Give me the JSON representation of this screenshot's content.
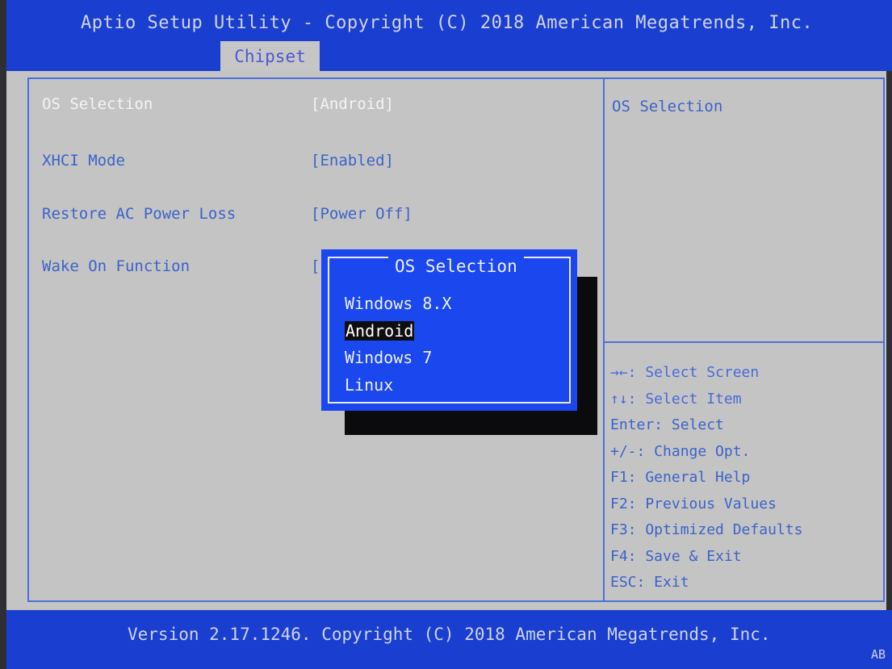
{
  "header": {
    "title": "Aptio Setup Utility - Copyright (C) 2018 American Megatrends, Inc.",
    "active_tab": "Chipset"
  },
  "settings": [
    {
      "label": "OS Selection",
      "value": "[Android]",
      "selected": true
    },
    {
      "label": "XHCI Mode",
      "value": "[Enabled]",
      "selected": false
    },
    {
      "label": "Restore AC Power Loss",
      "value": "[Power Off]",
      "selected": false
    },
    {
      "label": "Wake On Function",
      "value": "[",
      "selected": false
    }
  ],
  "help_panel": {
    "title": "OS Selection"
  },
  "keys": [
    "→←: Select Screen",
    "↑↓: Select Item",
    "Enter: Select",
    "+/-: Change Opt.",
    "F1: General Help",
    "F2: Previous Values",
    "F3: Optimized Defaults",
    "F4: Save & Exit",
    "ESC: Exit"
  ],
  "popup": {
    "title": "OS Selection",
    "options": [
      "Windows 8.X",
      "Android",
      "Windows 7",
      "Linux"
    ],
    "selected": "Android"
  },
  "footer": {
    "text": "Version 2.17.1246. Copyright (C) 2018 American Megatrends, Inc.",
    "code": "AB"
  },
  "colors": {
    "header_blue": "#1a3fd0",
    "panel_gray": "#c5c4c4",
    "text_blue": "#3b63c8",
    "popup_blue": "#1b47ee"
  }
}
